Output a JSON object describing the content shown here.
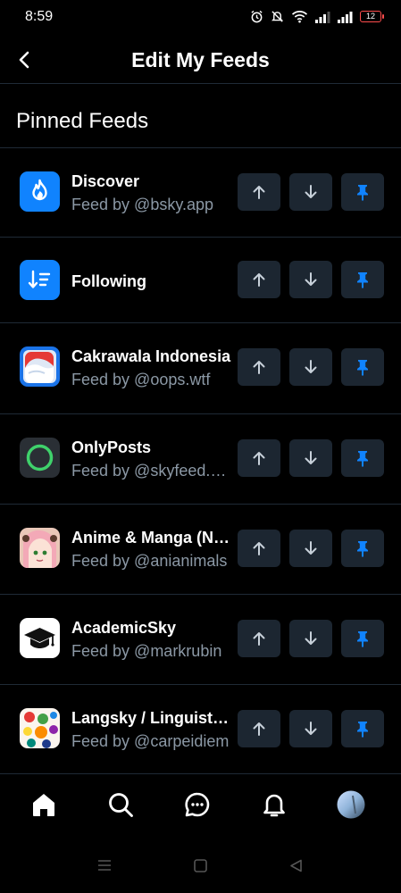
{
  "status": {
    "time": "8:59",
    "battery": "12"
  },
  "header": {
    "title": "Edit My Feeds"
  },
  "section": {
    "title": "Pinned Feeds"
  },
  "feeds": [
    {
      "name": "Discover",
      "by": "Feed by @bsky.app"
    },
    {
      "name": "Following",
      "by": ""
    },
    {
      "name": "Cakrawala Indonesia",
      "by": "Feed by @oops.wtf"
    },
    {
      "name": "OnlyPosts",
      "by": "Feed by @skyfeed.me"
    },
    {
      "name": "Anime & Manga (NSFW)",
      "by": "Feed by @anianimals"
    },
    {
      "name": "AcademicSky",
      "by": "Feed by @markrubin"
    },
    {
      "name": "Langsky / Linguistics",
      "by": "Feed by @carpeidiem"
    }
  ],
  "colors": {
    "accent": "#1083fe",
    "control_bg": "#1c2631",
    "muted_text": "#8b98a5",
    "divider": "#1f2a36"
  },
  "icons": {
    "controls": [
      "arrow-up-icon",
      "arrow-down-icon",
      "pin-icon"
    ],
    "tabbar": [
      "home-icon",
      "search-icon",
      "chat-icon",
      "bell-icon",
      "avatar"
    ],
    "sysnav": [
      "menu-icon",
      "home-square-icon",
      "back-triangle-icon"
    ]
  }
}
